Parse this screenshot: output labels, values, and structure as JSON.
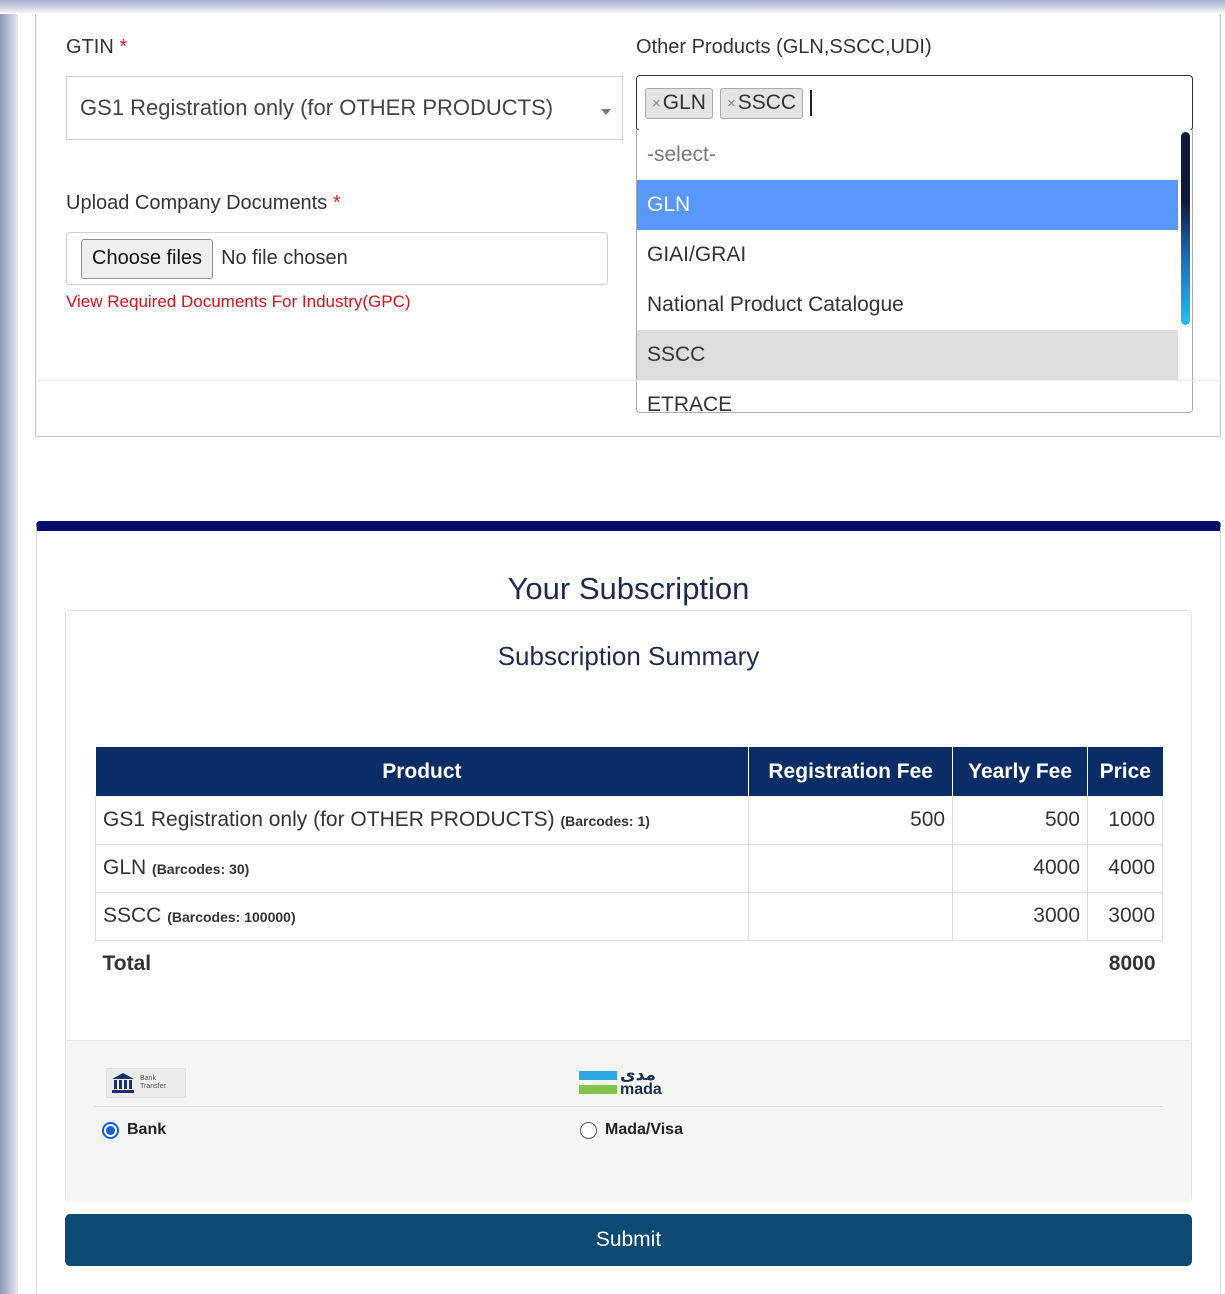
{
  "form": {
    "gtin_label": "GTIN",
    "required_mark": "*",
    "gtin_value": "GS1 Registration only (for OTHER PRODUCTS)",
    "upload_label": "Upload Company Documents",
    "choose_files": "Choose files",
    "no_file": "No file chosen",
    "docs_link": "View Required Documents For Industry(GPC)",
    "other_label": "Other Products (GLN,SSCC,UDI)",
    "tag_remove": "×",
    "selected_tags": [
      "GLN",
      "SSCC"
    ],
    "options": [
      "-select-",
      "GLN",
      "GIAI/GRAI",
      "National Product Catalogue",
      "SSCC",
      "ETRACE"
    ],
    "highlighted_option": "GLN"
  },
  "subscription": {
    "title": "Your Subscription",
    "summary_title": "Subscription Summary",
    "columns": [
      "Product",
      "Registration Fee",
      "Yearly Fee",
      "Price"
    ],
    "rows": [
      {
        "product": "GS1 Registration only (for OTHER PRODUCTS)",
        "barcodes": "(Barcodes: 1)",
        "registration_fee": "500",
        "yearly_fee": "500",
        "price": "1000"
      },
      {
        "product": "GLN",
        "barcodes": "(Barcodes: 30)",
        "registration_fee": "",
        "yearly_fee": "4000",
        "price": "4000"
      },
      {
        "product": "SSCC",
        "barcodes": "(Barcodes: 100000)",
        "registration_fee": "",
        "yearly_fee": "3000",
        "price": "3000"
      }
    ],
    "total_label": "Total",
    "total_value": "8000"
  },
  "payment": {
    "bank_logo_text_1": "Bank",
    "bank_logo_text_2": "Transfer",
    "mada_arabic": "مدى",
    "mada_english": "mada",
    "bank_label": "Bank",
    "mada_label": "Mada/Visa",
    "selected": "Bank"
  },
  "submit_label": "Submit",
  "colors": {
    "accent_navy": "#040d6d",
    "table_header": "#0a2d65",
    "submit_bg": "#0b4a72",
    "highlight": "#5897fb",
    "required": "#e02020"
  }
}
